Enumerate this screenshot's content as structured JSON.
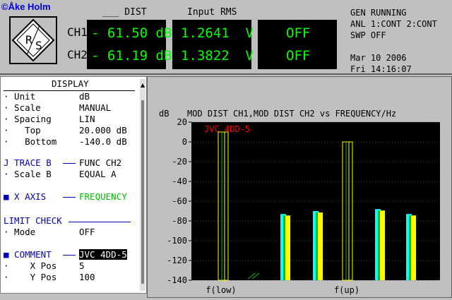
{
  "copyright": "©Åke Holm",
  "header": {
    "col1_label": "___ DIST",
    "col2_label": "Input RMS",
    "ch1_label": "CH1",
    "ch2_label": "CH2",
    "ch1_dist": "- 61.50 dB",
    "ch2_dist": "- 61.19 dB",
    "ch1_rms": "1.2641  V",
    "ch2_rms": "1.3822  V",
    "ch1_aux": "OFF",
    "ch2_aux": "OFF",
    "status_lines": [
      "GEN RUNNING",
      "ANL 1:CONT 2:CONT",
      "SWP OFF",
      "",
      "Mar 10 2006",
      "Fri 14:16:07"
    ]
  },
  "display_panel": {
    "title": "DISPLAY",
    "rows": [
      {
        "label": "· Unit",
        "value": "dB"
      },
      {
        "label": "· Scale",
        "value": "MANUAL"
      },
      {
        "label": "· Spacing",
        "value": "LIN"
      },
      {
        "label": "·   Top",
        "value": "20.000 dB"
      },
      {
        "label": "·   Bottom",
        "value": "-140.0 dB"
      },
      {
        "label": "J TRACE B",
        "value": "FUNC CH2"
      },
      {
        "label": "· Scale B",
        "value": "EQUAL A"
      },
      {
        "label": "■ X AXIS",
        "value": "FREQUENCY"
      },
      {
        "label": "LIMIT CHECK",
        "value": ""
      },
      {
        "label": "· Mode",
        "value": "OFF"
      },
      {
        "label": "■ COMMENT",
        "value": "JVC 4DD-5"
      },
      {
        "label": "·    X Pos",
        "value": "5"
      },
      {
        "label": "·    Y Pos",
        "value": "100"
      }
    ]
  },
  "chart_data": {
    "type": "bar",
    "title": "MOD DIST CH1,MOD DIST CH2 vs    FREQUENCY/Hz",
    "ylabel": "dB",
    "xlabel_ticks": [
      "f(low)",
      "f(up)"
    ],
    "annotation": "JVC 4DD-5",
    "ylim": [
      -140,
      20
    ],
    "yticks": [
      20,
      0,
      -20,
      -40,
      -60,
      -80,
      -100,
      -120,
      -140
    ],
    "series": [
      {
        "values": [
          10,
          -73,
          -70,
          0,
          -68,
          -73
        ]
      }
    ],
    "colors": {
      "ch1": "#00ffff",
      "ch2": "#ffff00",
      "ch2_b": "#00c000",
      "annotation": "#ff0000"
    }
  }
}
